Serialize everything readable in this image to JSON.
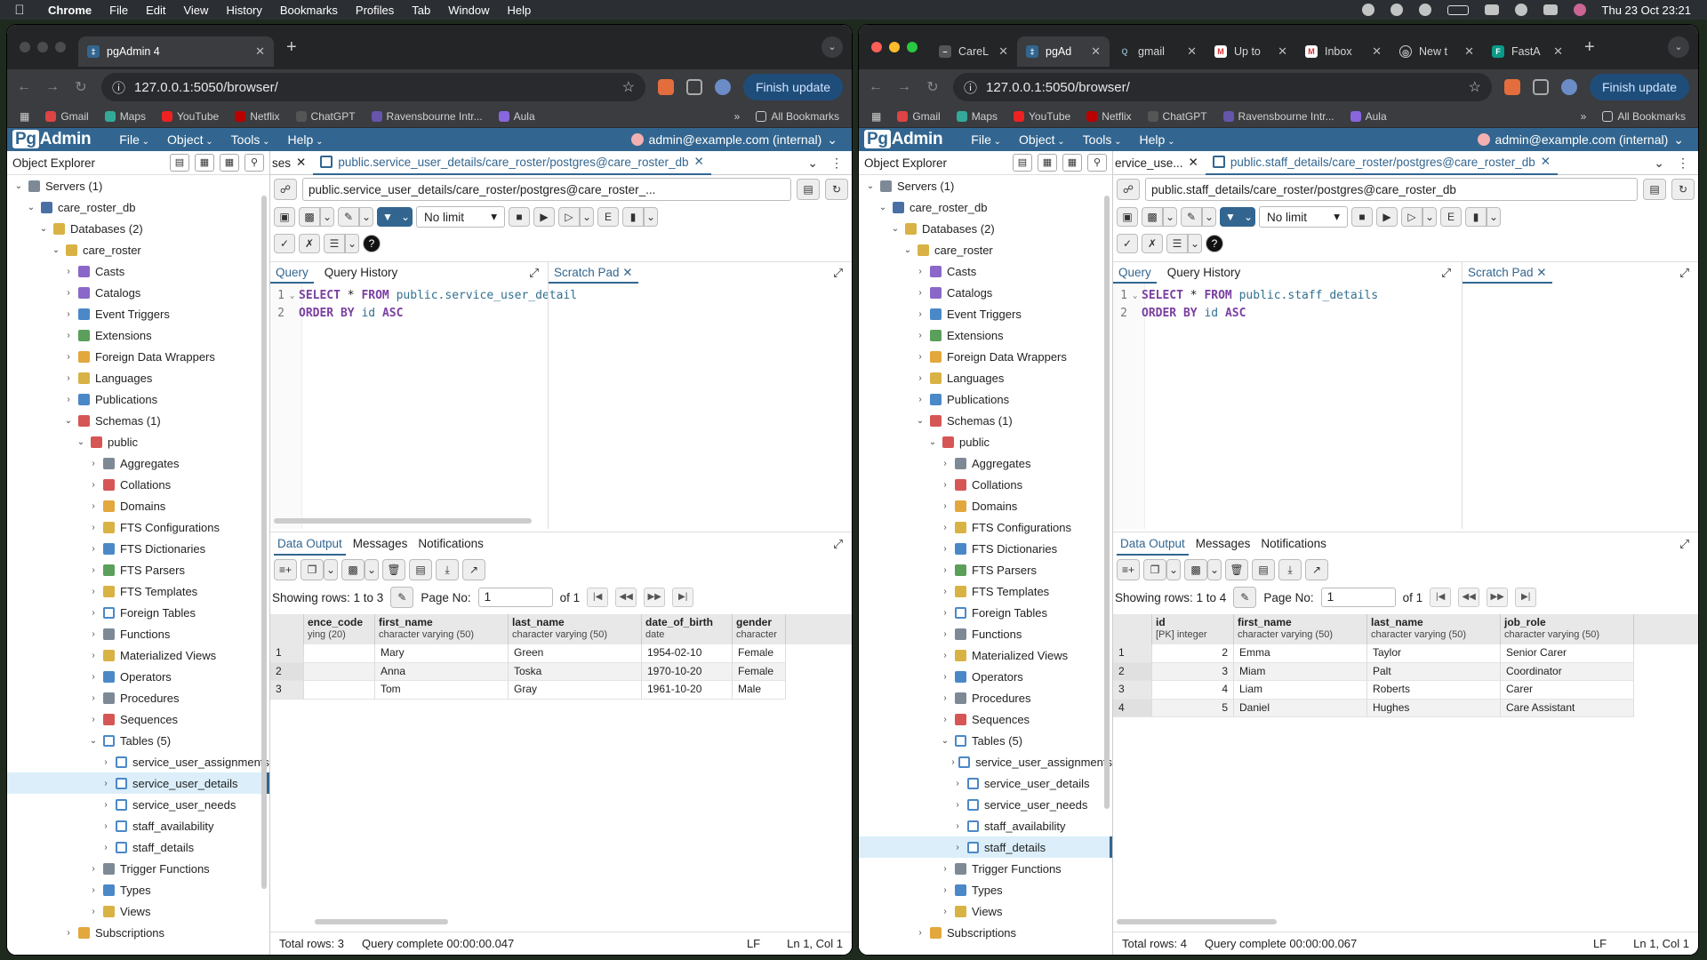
{
  "menubar": {
    "app": "Chrome",
    "items": [
      "File",
      "Edit",
      "View",
      "History",
      "Bookmarks",
      "Profiles",
      "Tab",
      "Window",
      "Help"
    ],
    "clock": "Thu 23 Oct  23:21"
  },
  "left": {
    "tabs": [
      {
        "label": "pgAdmin 4",
        "active": true
      }
    ],
    "url": "127.0.0.1:5050/browser/",
    "finish_update": "Finish update",
    "bookmarks": [
      "Gmail",
      "Maps",
      "YouTube",
      "Netflix",
      "ChatGPT",
      "Ravensbourne Intr...",
      "Aula"
    ],
    "all_bookmarks": "All Bookmarks",
    "query_tab_prev": "ses",
    "query_tab": "public.service_user_details/care_roster/postgres@care_roster_db",
    "connection": "public.service_user_details/care_roster/postgres@care_roster_...",
    "limit": "No limit",
    "code": {
      "line1_kw1": "SELECT",
      "line1_rest": " * ",
      "line1_kw2": "FROM",
      "line1_id": " public.service_user_detail",
      "line2_kw": "ORDER BY",
      "line2_id": " id ",
      "line2_kw2": "ASC"
    },
    "showing": "Showing rows: 1 to 3",
    "page_no_label": "Page No:",
    "page_no": "1",
    "of": "of 1",
    "columns": [
      {
        "name": "ence_code",
        "type": "ying (20)"
      },
      {
        "name": "first_name",
        "type": "character varying (50)"
      },
      {
        "name": "last_name",
        "type": "character varying (50)"
      },
      {
        "name": "date_of_birth",
        "type": "date"
      },
      {
        "name": "gender",
        "type": "character"
      }
    ],
    "rows": [
      [
        "1",
        "",
        "Mary",
        "Green",
        "1954-02-10",
        "Female"
      ],
      [
        "2",
        "",
        "Anna",
        "Toska",
        "1970-10-20",
        "Female"
      ],
      [
        "3",
        "",
        "Tom",
        "Gray",
        "1961-10-20",
        "Male"
      ]
    ],
    "total_rows": "Total rows: 3",
    "query_complete": "Query complete 00:00:00.047",
    "tree_schema_label": "Schemas (1)"
  },
  "right": {
    "tabs": [
      {
        "label": "CareL",
        "active": false
      },
      {
        "label": "pgAd",
        "active": true
      },
      {
        "label": "gmail",
        "active": false
      },
      {
        "label": "Up to",
        "active": false
      },
      {
        "label": "Inbox",
        "active": false
      },
      {
        "label": "New t",
        "active": false
      },
      {
        "label": "FastA",
        "active": false
      }
    ],
    "url": "127.0.0.1:5050/browser/",
    "finish_update": "Finish update",
    "bookmarks": [
      "Gmail",
      "Maps",
      "YouTube",
      "Netflix",
      "ChatGPT",
      "Ravensbourne Intr...",
      "Aula"
    ],
    "all_bookmarks": "All Bookmarks",
    "query_tab_prev": "ervice_use...",
    "query_tab": "public.staff_details/care_roster/postgres@care_roster_db",
    "connection": "public.staff_details/care_roster/postgres@care_roster_db",
    "limit": "No limit",
    "code": {
      "line1_kw1": "SELECT",
      "line1_rest": " * ",
      "line1_kw2": "FROM",
      "line1_id": " public.staff_details",
      "line2_kw": "ORDER BY",
      "line2_id": " id ",
      "line2_kw2": "ASC"
    },
    "showing": "Showing rows: 1 to 4",
    "page_no_label": "Page No:",
    "page_no": "1",
    "of": "of 1",
    "columns": [
      {
        "name": "id",
        "type": "[PK] integer"
      },
      {
        "name": "first_name",
        "type": "character varying (50)"
      },
      {
        "name": "last_name",
        "type": "character varying (50)"
      },
      {
        "name": "job_role",
        "type": "character varying (50)"
      }
    ],
    "rows": [
      [
        "1",
        "2",
        "Emma",
        "Taylor",
        "Senior Carer"
      ],
      [
        "2",
        "3",
        "Miam",
        "Palt",
        "Coordinator"
      ],
      [
        "3",
        "4",
        "Liam",
        "Roberts",
        "Carer"
      ],
      [
        "4",
        "5",
        "Daniel",
        "Hughes",
        "Care Assistant"
      ]
    ],
    "total_rows": "Total rows: 4",
    "query_complete": "Query complete 00:00:00.067",
    "tree_schema_label": "Schemas (1)"
  },
  "pgadmin": {
    "menus": [
      "File",
      "Object",
      "Tools",
      "Help"
    ],
    "user": "admin@example.com (internal)",
    "explorer_title": "Object Explorer",
    "query_label": "Query",
    "history_label": "Query History",
    "scratch_label": "Scratch Pad",
    "data_output": "Data Output",
    "messages": "Messages",
    "notifications": "Notifications",
    "lf": "LF",
    "pos": "Ln 1, Col 1",
    "tree": {
      "servers": "Servers (1)",
      "server": "care_roster_db",
      "databases": "Databases (2)",
      "db": "care_roster",
      "db_children": [
        "Casts",
        "Catalogs",
        "Event Triggers",
        "Extensions",
        "Foreign Data Wrappers",
        "Languages",
        "Publications"
      ],
      "schema": "public",
      "schema_children": [
        "Aggregates",
        "Collations",
        "Domains",
        "FTS Configurations",
        "FTS Dictionaries",
        "FTS Parsers",
        "FTS Templates",
        "Foreign Tables",
        "Functions",
        "Materialized Views",
        "Operators",
        "Procedures",
        "Sequences"
      ],
      "tables": "Tables (5)",
      "table_list": [
        "service_user_assignments",
        "service_user_details",
        "service_user_needs",
        "staff_availability",
        "staff_details"
      ],
      "after_tables": [
        "Trigger Functions",
        "Types",
        "Views"
      ],
      "subscriptions": "Subscriptions"
    }
  }
}
